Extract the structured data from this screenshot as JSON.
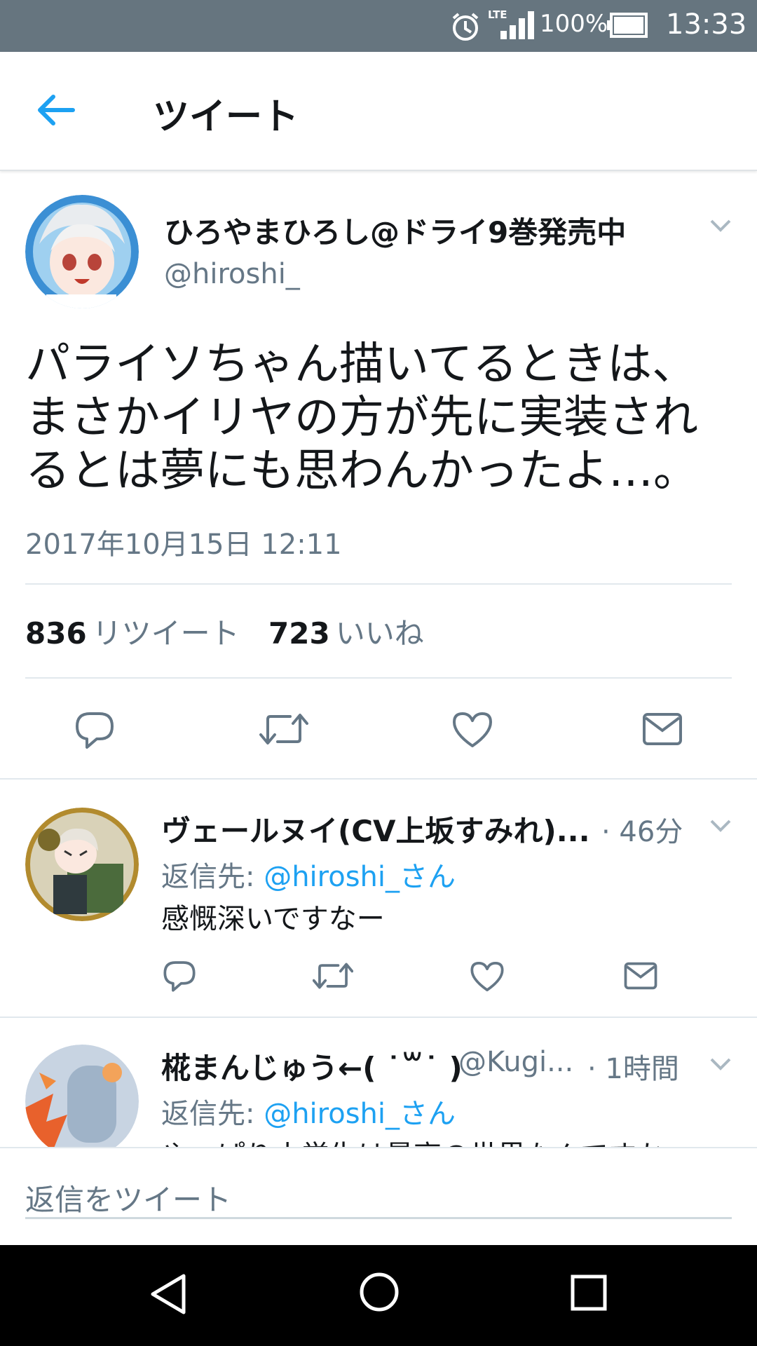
{
  "status_bar": {
    "network": "LTE",
    "battery": "100%",
    "time": "13:33"
  },
  "header": {
    "title": "ツイート"
  },
  "tweet": {
    "display_name": "ひろやまひろし@ドライ9巻発売中",
    "handle": "@hiroshi_",
    "text": "パライソちゃん描いてるときは、まさかイリヤの方が先に実装されるとは夢にも思わんかったよ…。",
    "timestamp": "2017年10月15日 12:11",
    "retweet_count": "836",
    "retweet_label": "リツイート",
    "like_count": "723",
    "like_label": "いいね"
  },
  "replies": [
    {
      "display_name": "ヴェールヌイ(CV上坂すみれ)...",
      "time": "· 46分",
      "reply_prefix": "返信先:",
      "reply_to": "@hiroshi_さん",
      "text": "感慨深いですなー"
    },
    {
      "display_name": "椛まんじゅう←( ˙꒳˙ )",
      "handle": "@Kugi...",
      "time": "· 1時間",
      "reply_prefix": "返信先:",
      "reply_to": "@hiroshi_さん",
      "text": "やっぱり小学生は最高の世界なんですか"
    }
  ],
  "composer": {
    "placeholder": "返信をツイート"
  },
  "colors": {
    "accent": "#1da1f2",
    "secondary_text": "#657786",
    "status_bar": "#66757f"
  },
  "icons": [
    "alarm-icon",
    "signal-icon",
    "battery-icon",
    "back-arrow-icon",
    "chevron-down-icon",
    "reply-icon",
    "retweet-icon",
    "like-icon",
    "dm-icon",
    "nav-back-icon",
    "nav-home-icon",
    "nav-recents-icon"
  ]
}
